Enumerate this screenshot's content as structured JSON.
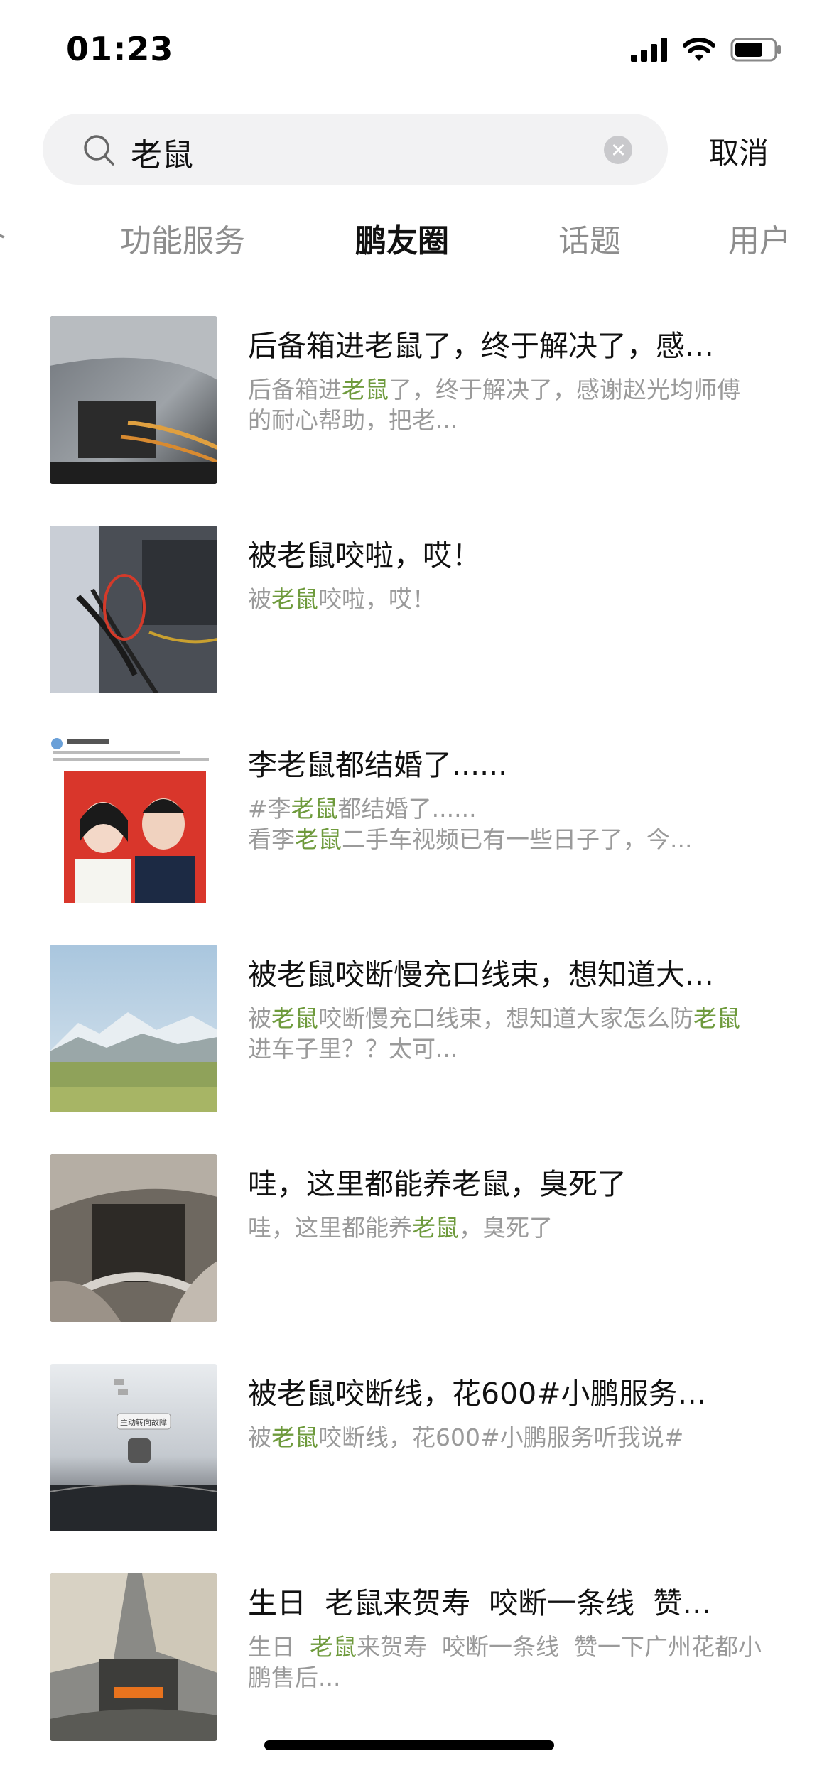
{
  "status": {
    "time": "01:23",
    "icons": [
      "signal-icon",
      "wifi-icon",
      "battery-icon"
    ]
  },
  "search": {
    "value": "老鼠",
    "cancel_label": "取消"
  },
  "tabs": [
    {
      "label": "合",
      "active": false
    },
    {
      "label": "功能服务",
      "active": false
    },
    {
      "label": "鹏友圈",
      "active": true
    },
    {
      "label": "话题",
      "active": false
    },
    {
      "label": "用户",
      "active": false
    }
  ],
  "highlight_color": "#6e9a3c",
  "results": [
    {
      "title": "后备箱进老鼠了，终于解决了，感…",
      "desc": [
        "后备箱进",
        "老鼠",
        "了，终于解决了，感谢赵光均师傅的耐心帮助，把老..."
      ],
      "thumb": "photo of car trunk wiring"
    },
    {
      "title": "被老鼠咬啦，哎！",
      "desc": [
        "被",
        "老鼠",
        "咬啦，哎！"
      ],
      "thumb": "photo of chewed wire circled in red"
    },
    {
      "title": "李老鼠都结婚了......",
      "desc": [
        "#李",
        "老鼠",
        "都结婚了......\n看李",
        "老鼠",
        "二手车视频已有一些日子了，今..."
      ],
      "thumb": "screenshot of wedding photo post"
    },
    {
      "title": "被老鼠咬断慢充口线束，想知道大…",
      "desc": [
        "被",
        "老鼠",
        "咬断慢充口线束，想知道大家怎么防",
        "老鼠",
        "进车子里？？太可..."
      ],
      "thumb": "landscape photo of snowy mountains"
    },
    {
      "title": "哇，这里都能养老鼠，臭死了",
      "desc": [
        "哇，这里都能养",
        "老鼠",
        "，臭死了"
      ],
      "thumb": "photo of dirty engine compartment"
    },
    {
      "title": "被老鼠咬断线，花600#小鹏服务…",
      "desc": [
        "被",
        "老鼠",
        "咬断线，花600#小鹏服务听我说#"
      ],
      "thumb": "photo of car dashboard warning",
      "thumb_text": "主动转向故障"
    },
    {
      "title": "生日  老鼠来贺寿  咬断一条线  赞…",
      "desc": [
        "生日  ",
        "老鼠",
        "来贺寿  咬断一条线  赞一下广州花都小鹏售后..."
      ],
      "thumb": "photo of car interior with orange cable"
    }
  ]
}
